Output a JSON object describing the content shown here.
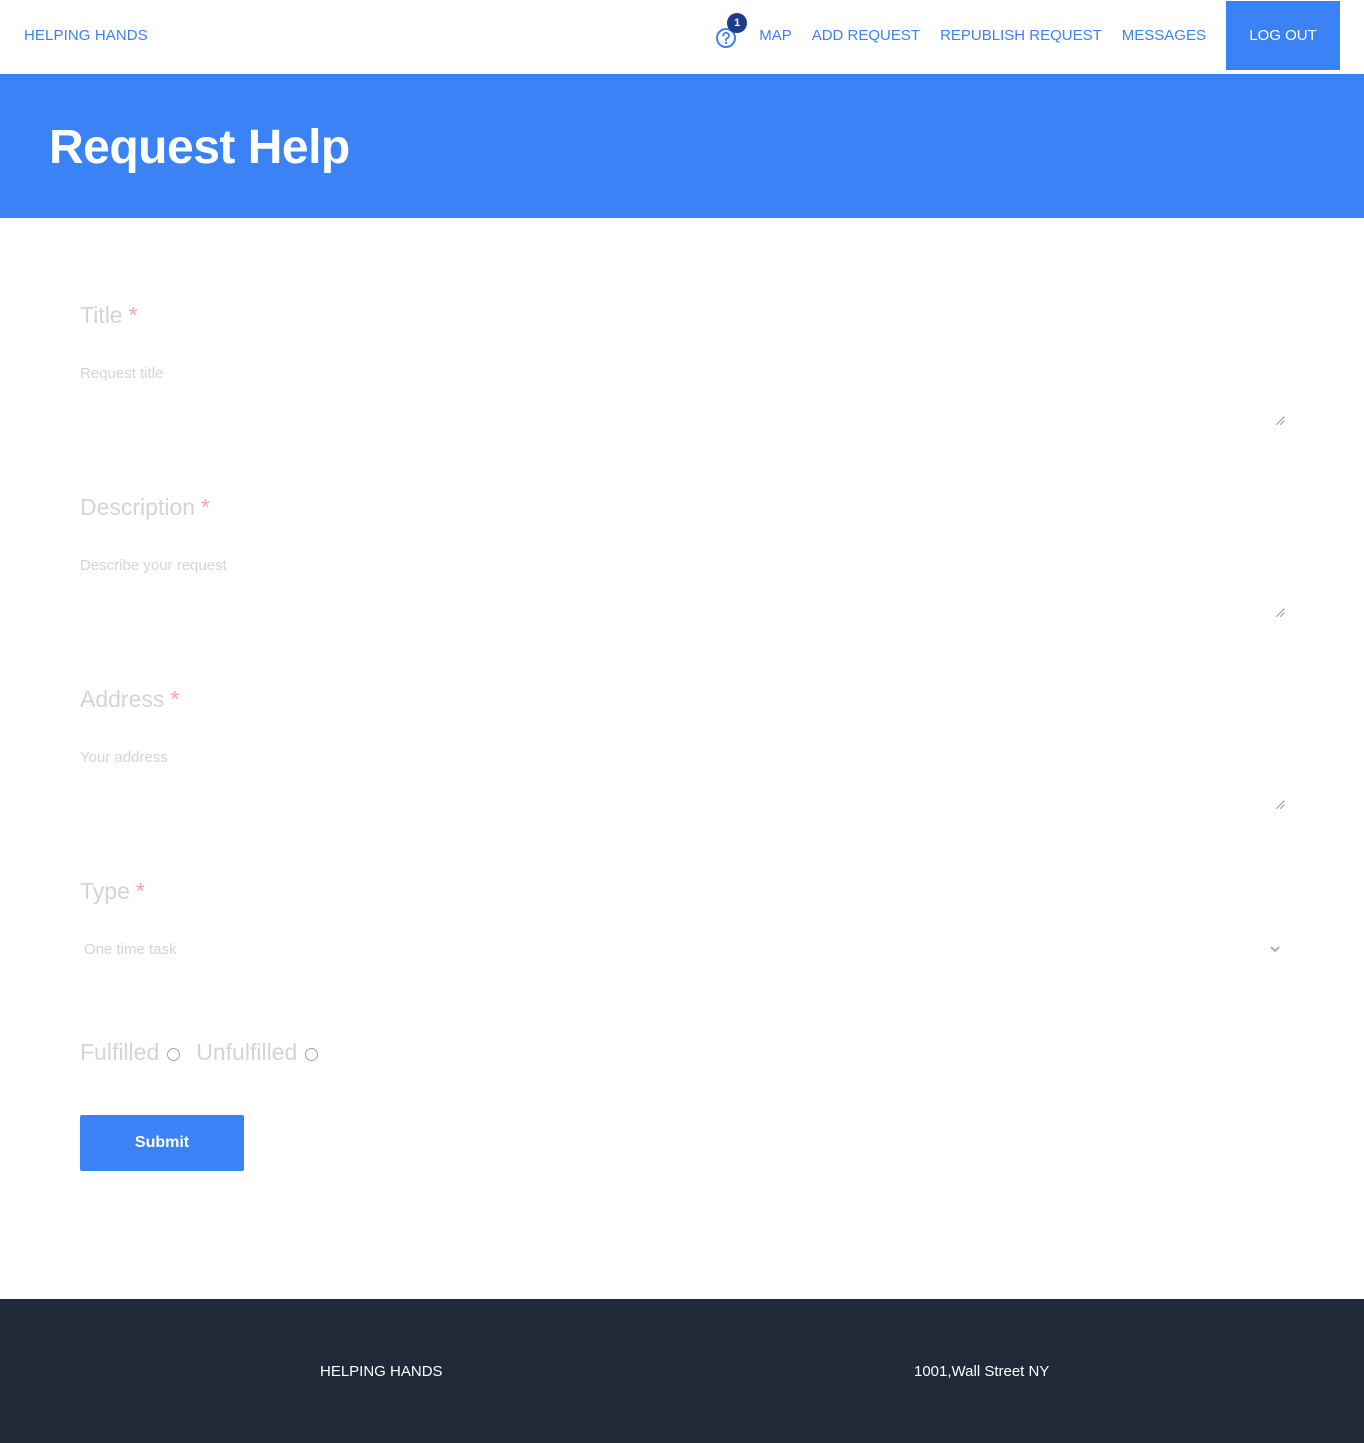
{
  "header": {
    "brand": "HELPING HANDS",
    "notification_count": "1",
    "nav": {
      "map": "MAP",
      "add_request": "ADD REQUEST",
      "republish_request": "REPUBLISH REQUEST",
      "messages": "MESSAGES",
      "logout": "LOG OUT"
    }
  },
  "hero": {
    "title": "Request Help"
  },
  "form": {
    "required_mark": "*",
    "title": {
      "label": "Title",
      "placeholder": "Request title",
      "value": ""
    },
    "description": {
      "label": "Description",
      "placeholder": "Describe your request",
      "value": ""
    },
    "address": {
      "label": "Address",
      "placeholder": "Your address",
      "value": ""
    },
    "type": {
      "label": "Type",
      "selected": "One time task"
    },
    "status_options": [
      "Fulfilled",
      "Unfulfilled"
    ],
    "submit_label": "Submit"
  },
  "footer": {
    "brand": "HELPING HANDS",
    "address": "1001,Wall Street NY"
  },
  "colors": {
    "accent": "#3b82f6",
    "badge": "#1e3a8a",
    "footer_bg": "#1f2937",
    "required": "#fca5a5",
    "muted_text": "#d1d5db"
  }
}
